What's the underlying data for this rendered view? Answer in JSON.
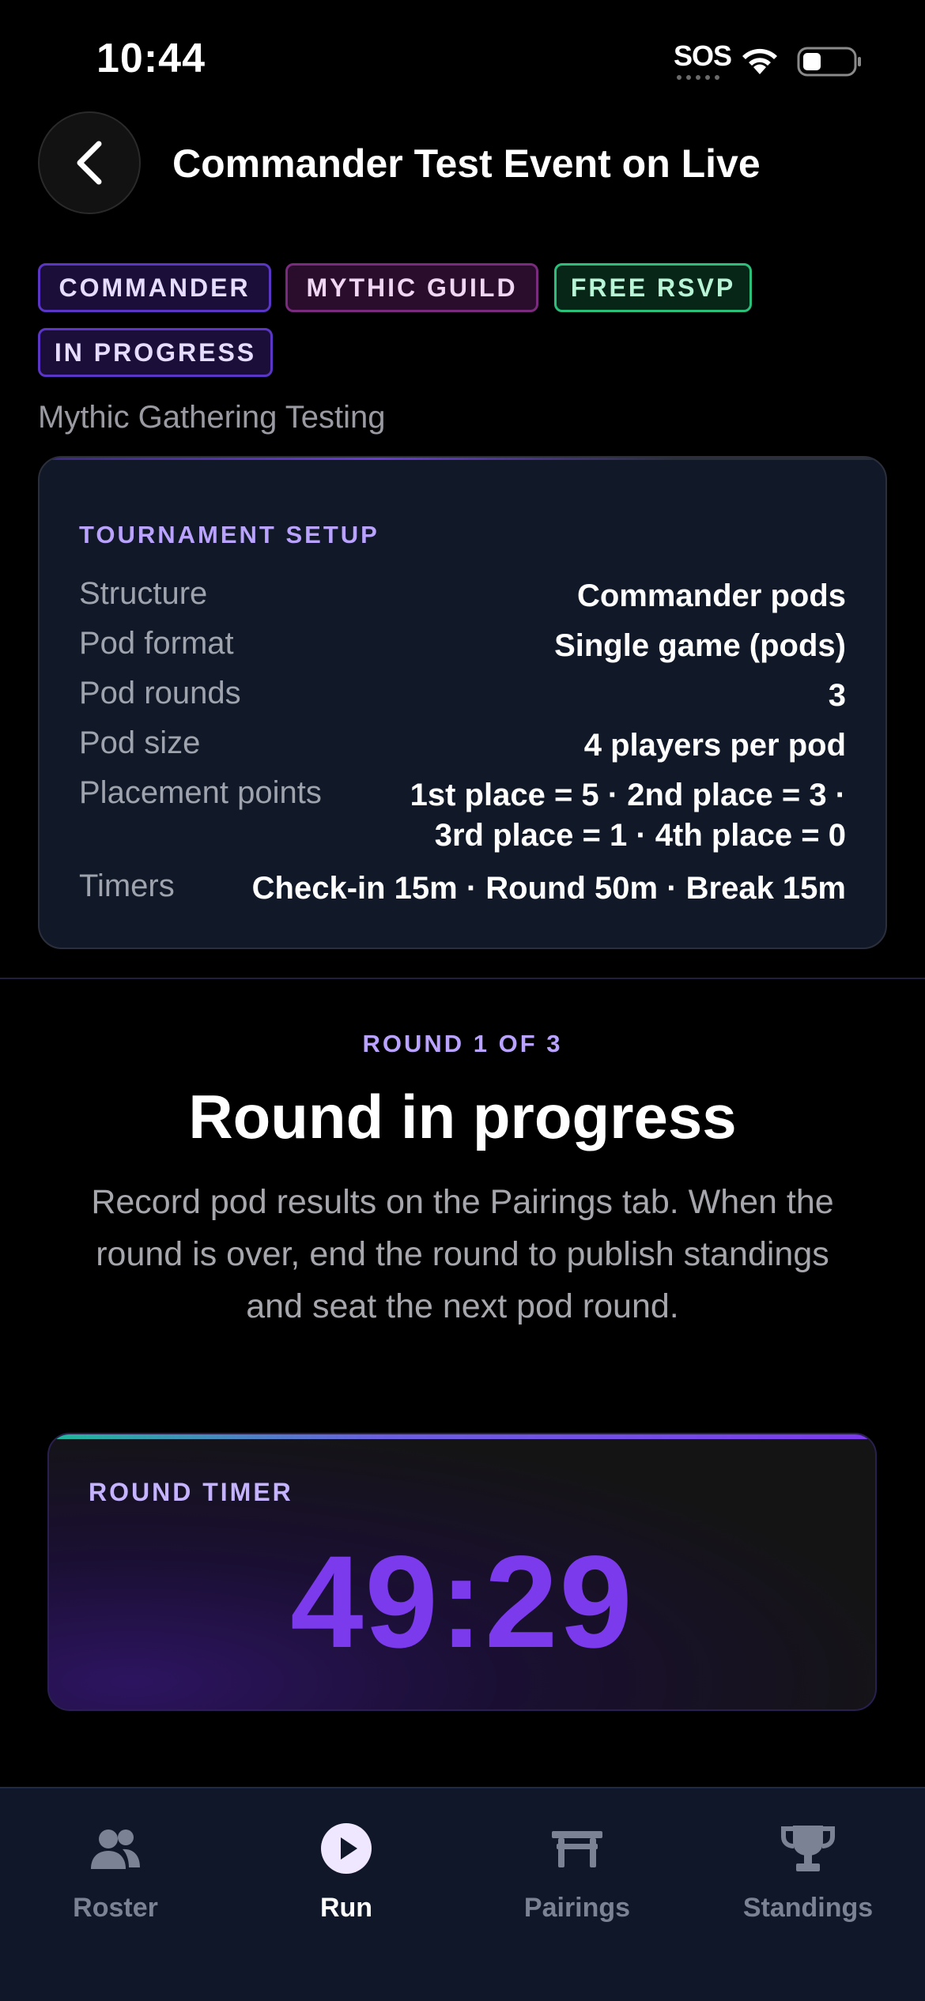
{
  "status_bar": {
    "time": "10:44",
    "sos": "SOS",
    "icons": [
      "wifi-icon",
      "battery-icon"
    ]
  },
  "header": {
    "back_icon": "chevron-left-icon",
    "title": "Commander Test Event on Live"
  },
  "tags": [
    {
      "label": "COMMANDER",
      "color": "#5b36c4"
    },
    {
      "label": "MYTHIC GUILD",
      "color": "#7a2b7e"
    },
    {
      "label": "FREE RSVP",
      "color": "#2bbf7a"
    },
    {
      "label": "IN PROGRESS",
      "color": "#5b36c4"
    }
  ],
  "subtitle": "Mythic Gathering Testing",
  "setup": {
    "heading": "TOURNAMENT SETUP",
    "rows": [
      {
        "key": "Structure",
        "value": "Commander pods"
      },
      {
        "key": "Pod format",
        "value": "Single game (pods)"
      },
      {
        "key": "Pod rounds",
        "value": "3"
      },
      {
        "key": "Pod size",
        "value": "4 players per pod"
      },
      {
        "key": "Placement points",
        "value_line1": "1st place = 5 · 2nd place = 3 ·",
        "value_line2": "3rd place = 1 · 4th place = 0"
      },
      {
        "key": "Timers",
        "value": "Check-in 15m · Round 50m · Break 15m"
      }
    ]
  },
  "round": {
    "label": "ROUND 1 OF 3",
    "heading": "Round in progress",
    "description": "Record pod results on the Pairings tab. When the round is over, end the round to publish standings and seat the next pod round."
  },
  "timer": {
    "label": "ROUND TIMER",
    "value": "49:29",
    "accent_color": "#7c3aed"
  },
  "tab_bar": {
    "tabs": [
      {
        "label": "Roster",
        "icon": "people-icon",
        "active": false
      },
      {
        "label": "Run",
        "icon": "play-icon",
        "active": true
      },
      {
        "label": "Pairings",
        "icon": "table-icon",
        "active": false
      },
      {
        "label": "Standings",
        "icon": "trophy-icon",
        "active": false
      }
    ]
  }
}
